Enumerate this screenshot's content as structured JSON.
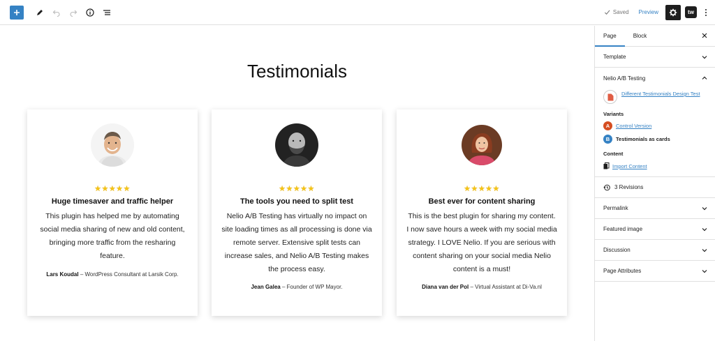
{
  "toolbar": {
    "add_icon": "plus-icon",
    "tools_icon": "pencil-icon",
    "undo_icon": "undo-icon",
    "redo_icon": "redo-icon",
    "info_icon": "info-icon",
    "outline_icon": "list-view-icon",
    "saved_label": "Saved",
    "preview_label": "Preview",
    "settings_icon": "gear-icon",
    "plugin_label": "tw",
    "more_icon": "kebab-icon"
  },
  "page": {
    "title": "Testimonials"
  },
  "testimonials": [
    {
      "title": "Huge timesaver and traffic helper",
      "body": "This plugin has helped me by automating social media sharing of new and old content, bringing more traffic from the resharing feature.",
      "author": "Lars Koudal",
      "role": " – WordPress Consultant at Larsik Corp.",
      "stars": "★★★★★"
    },
    {
      "title": "The tools you need to split test",
      "body": "Nelio A/B Testing has virtually no impact on site loading times as all processing is done via remote server. Extensive split tests can increase sales, and Nelio A/B Testing makes the process easy.",
      "author": "Jean Galea",
      "role": " – Founder of WP Mayor.",
      "stars": "★★★★★"
    },
    {
      "title": "Best ever for content sharing",
      "body": "This is the best plugin for sharing my content. I now save hours a week with my social media strategy. I LOVE Nelio. If you are serious with content sharing on your social media Nelio content is a must!",
      "author": "Diana van der Pol",
      "role": " – Virtual Assistant at Di-Va.nl",
      "stars": "★★★★★"
    }
  ],
  "sidebar": {
    "tabs": [
      "Page",
      "Block"
    ],
    "template_label": "Template",
    "nelio_label": "Nelio A/B Testing",
    "experiment_link": "Different Testimonials Design Test",
    "variants_label": "Variants",
    "variants": [
      {
        "badge": "A",
        "label": "Control Version",
        "color": "#d54e21"
      },
      {
        "badge": "B",
        "label": "Testimonials as cards",
        "color": "#3582c4"
      }
    ],
    "content_label": "Content",
    "import_label": "Import Content",
    "revisions_label": "3 Revisions",
    "panels": [
      "Permalink",
      "Featured image",
      "Discussion",
      "Page Attributes"
    ]
  },
  "colors": {
    "accent": "#3582c4",
    "star": "#f5c518"
  }
}
